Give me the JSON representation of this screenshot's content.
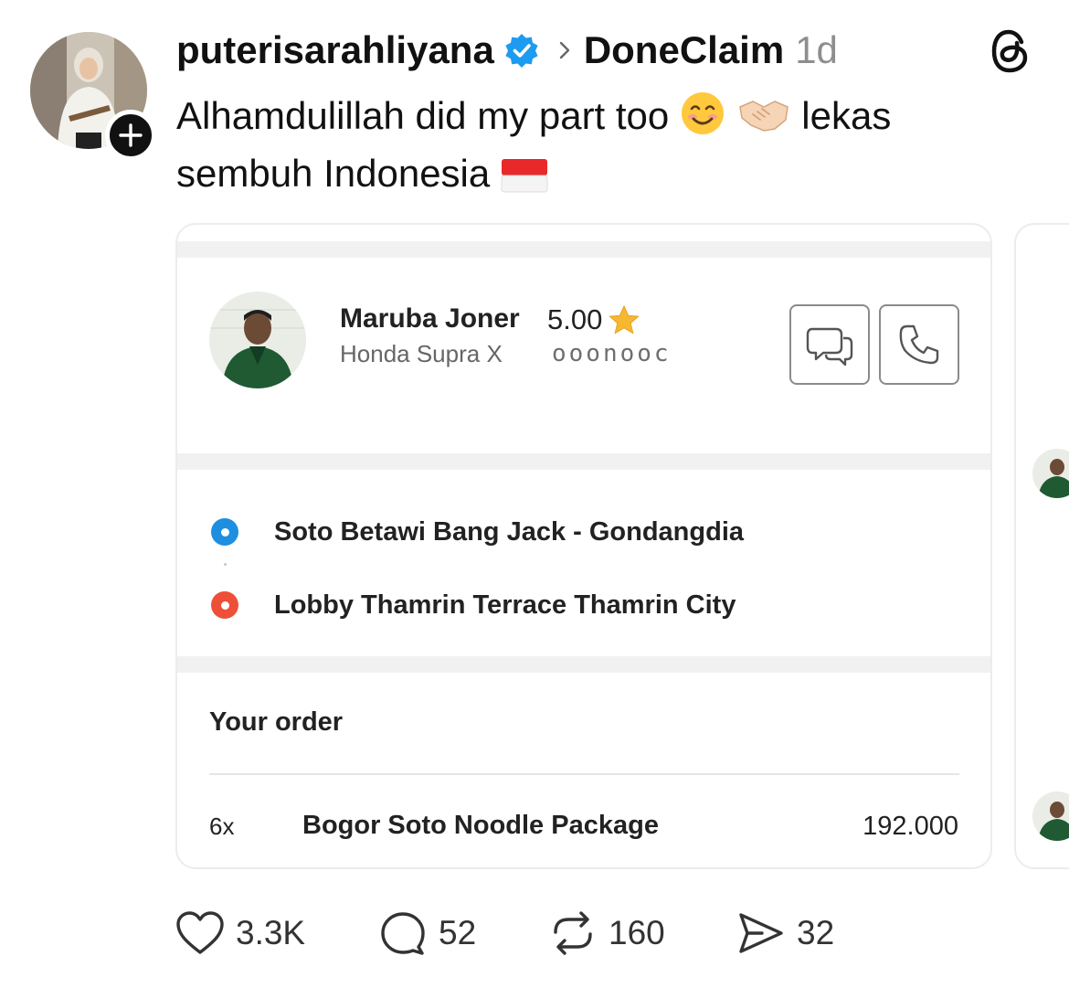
{
  "post": {
    "username": "puterisarahliyana",
    "community": "DoneClaim",
    "time": "1d",
    "text_line1_a": "Alhamdulillah did my part too",
    "text_line1_b": "lekas",
    "text_line2": "sembuh Indonesia",
    "icons": [
      "verified-badge-icon",
      "chevron-right-icon",
      "threads-logo-icon",
      "smiling-face-emoji",
      "handshake-emoji",
      "indonesia-flag-emoji",
      "follow-plus-icon"
    ]
  },
  "card": {
    "driver": {
      "name": "Maruba Joner",
      "rating": "5.00",
      "vehicle": "Honda Supra X",
      "plate": "ooonooc"
    },
    "route": {
      "pickup": "Soto Betawi Bang Jack - Gondangdia",
      "dropoff": "Lobby Thamrin Terrace Thamrin City"
    },
    "order": {
      "title": "Your order",
      "items": [
        {
          "qty": "6x",
          "name": "Bogor Soto Noodle Package",
          "price": "192.000"
        }
      ]
    }
  },
  "actions": {
    "likes": "3.3K",
    "comments": "52",
    "reposts": "160",
    "shares": "32"
  },
  "colors": {
    "verified": "#1d9bf0",
    "pickup_dot": "#1e8fe0",
    "dropoff_dot": "#ee4f38",
    "star": "#f7b731",
    "band": "#f1f1f1"
  }
}
